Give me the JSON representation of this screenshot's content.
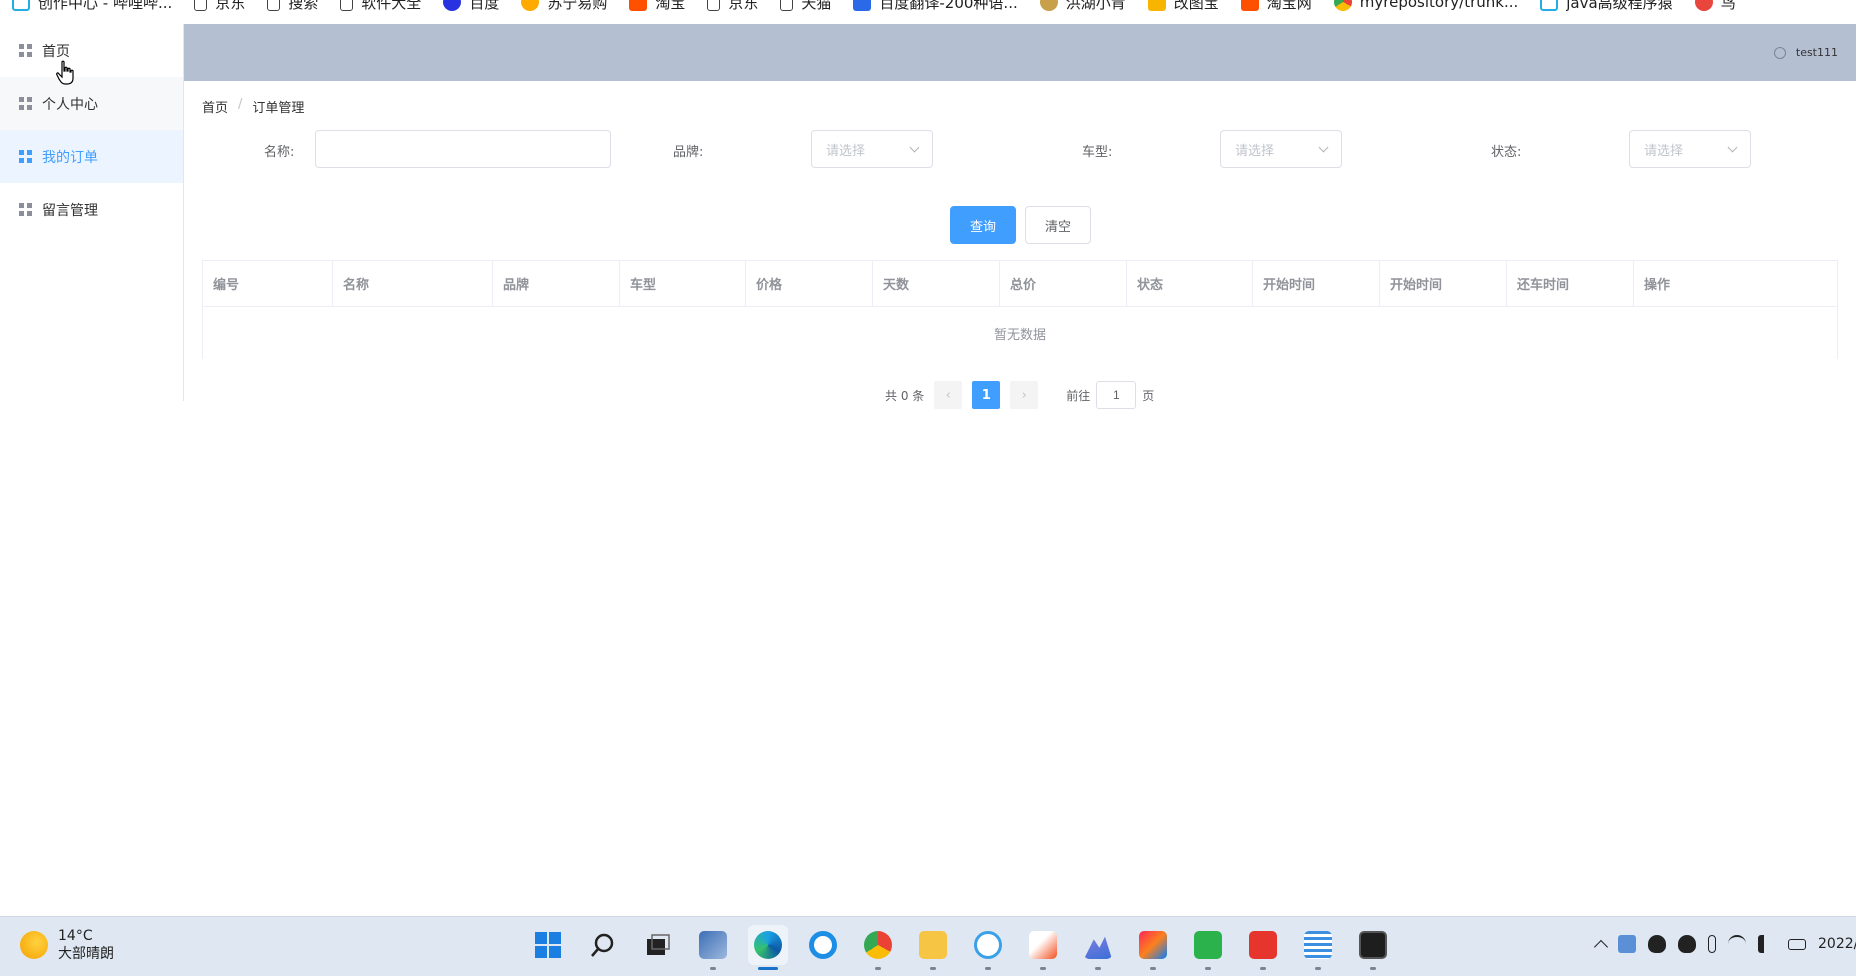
{
  "bookmarks": [
    {
      "label": "创作中心 - 哔哩哔...",
      "icon": "bilibili-icon",
      "color": "#23ade5"
    },
    {
      "label": "京东",
      "icon": "page-icon",
      "color": "#ffffff"
    },
    {
      "label": "搜索",
      "icon": "page-icon",
      "color": "#ffffff"
    },
    {
      "label": "软件大全",
      "icon": "page-icon",
      "color": "#ffffff"
    },
    {
      "label": "百度",
      "icon": "baidu-icon",
      "color": "#2932e1"
    },
    {
      "label": "苏宁易购",
      "icon": "suning-icon",
      "color": "#ffaa00"
    },
    {
      "label": "淘宝",
      "icon": "taobao-icon",
      "color": "#ff5000"
    },
    {
      "label": "京东",
      "icon": "page-icon",
      "color": "#ffffff"
    },
    {
      "label": "天猫",
      "icon": "page-icon",
      "color": "#ffffff"
    },
    {
      "label": "百度翻译-200种语...",
      "icon": "translate-icon",
      "color": "#2a6ae9"
    },
    {
      "label": "洪湖小肯",
      "icon": "hh-icon",
      "color": "#c8a04a"
    },
    {
      "label": "改图宝",
      "icon": "gaitubao-icon",
      "color": "#f7b500"
    },
    {
      "label": "淘宝网",
      "icon": "taobao-icon",
      "color": "#ff5000"
    },
    {
      "label": "myrepository/trunk...",
      "icon": "chrome-icon",
      "color": "#34a853"
    },
    {
      "label": "java高级程序猿",
      "icon": "bilibili-icon",
      "color": "#23ade5"
    },
    {
      "label": "鸟",
      "icon": "bird-icon",
      "color": "#e8453c"
    }
  ],
  "sidebar": {
    "items": [
      {
        "label": "首页"
      },
      {
        "label": "个人中心"
      },
      {
        "label": "我的订单"
      },
      {
        "label": "留言管理"
      }
    ]
  },
  "header": {
    "username": "test111"
  },
  "breadcrumb": {
    "home": "首页",
    "sep": "/",
    "current": "订单管理"
  },
  "filters": {
    "name_label": "名称:",
    "name_value": "",
    "brand_label": "品牌:",
    "brand_placeholder": "请选择",
    "model_label": "车型:",
    "model_placeholder": "请选择",
    "status_label": "状态:",
    "status_placeholder": "请选择"
  },
  "buttons": {
    "query": "查询",
    "clear": "清空"
  },
  "table": {
    "columns": [
      "编号",
      "名称",
      "品牌",
      "车型",
      "价格",
      "天数",
      "总价",
      "状态",
      "开始时间",
      "开始时间",
      "还车时间",
      "操作"
    ],
    "empty_text": "暂无数据"
  },
  "pagination": {
    "total_text": "共 0 条",
    "prev": "‹",
    "next": "›",
    "current_page": "1",
    "goto_label": "前往",
    "goto_value": "1",
    "page_suffix": "页"
  },
  "taskbar": {
    "temperature": "14°C",
    "weather": "大部晴朗",
    "clock": "2022/"
  },
  "colors": {
    "primary": "#409eff",
    "header_bg": "#b4c0d2",
    "taskbar_bg": "#dfe8f2"
  }
}
